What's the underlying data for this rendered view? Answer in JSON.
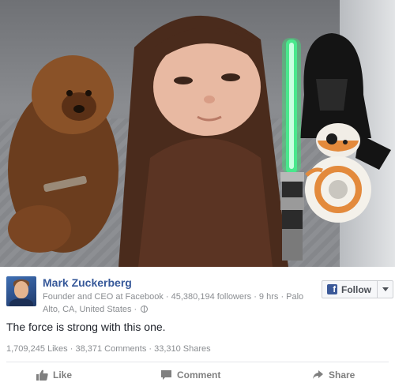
{
  "post": {
    "author_name": "Mark Zuckerberg",
    "meta_line": "Founder and CEO at Facebook · 45,380,194 followers · 9 hrs · Palo Alto, CA, United States ·",
    "text": "The force is strong with this one.",
    "stats": "1,709,245 Likes · 38,371 Comments · 33,310 Shares"
  },
  "follow": {
    "label": "Follow",
    "icon_letter": "f"
  },
  "actions": {
    "like": "Like",
    "comment": "Comment",
    "share": "Share"
  },
  "colors": {
    "name_link": "#365899",
    "facebook_blue": "#3b5998",
    "meta_gray": "#8a8d91",
    "action_gray": "#7f7f7f"
  },
  "icons": {
    "follow": "facebook-icon",
    "privacy": "globe-icon",
    "like": "thumbs-up-icon",
    "comment": "speech-bubble-icon",
    "share": "share-arrow-icon"
  }
}
